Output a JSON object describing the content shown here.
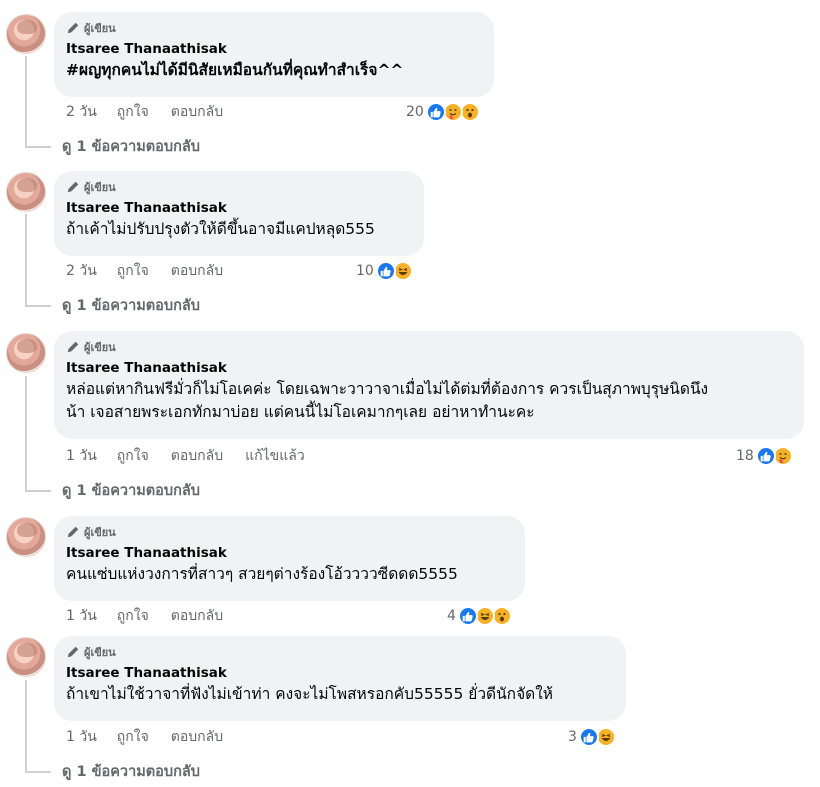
{
  "badge_label": "ผู้เขียน",
  "comments": [
    {
      "author": "Itsaree Thanaathisak",
      "text": "#ผญทุกคนไม่ได้มีนิสัยเหมือนกันที่คุณทำสำเร็จ^^",
      "time": "2 วัน",
      "like": "ถูกใจ",
      "reply": "ตอบกลับ",
      "reaction_count": "20",
      "reaction_icons": [
        "like-icon",
        "care-icon",
        "wow-icon"
      ],
      "view_replies": "ดู 1 ข้อความตอบกลับ"
    },
    {
      "author": "Itsaree Thanaathisak",
      "text": "ถ้าเค้าไม่ปรับปรุงตัวให้ดีขึ้นอาจมีแคปหลุด555",
      "time": "2 วัน",
      "like": "ถูกใจ",
      "reply": "ตอบกลับ",
      "reaction_count": "10",
      "reaction_icons": [
        "like-icon",
        "haha-icon"
      ],
      "view_replies": "ดู 1 ข้อความตอบกลับ"
    },
    {
      "author": "Itsaree Thanaathisak",
      "text_line1": "หล่อแต่หากินฟรีมั่วก็ไม่โอเคค่ะ โดยเฉพาะวาวาจาเมื่อไม่ได้ต่มที่ต้องการ ควรเป็นสุภาพบุรุษนิดนึง",
      "text_line2": "น้า เจอสายพระเอกทักมาบ่อย แต่คนนี้ไม่โอเคมากๆเลย อย่าหาทำนะคะ",
      "time": "1 วัน",
      "like": "ถูกใจ",
      "reply": "ตอบกลับ",
      "edited": "แก้ไขแล้ว",
      "reaction_count": "18",
      "reaction_icons": [
        "like-icon",
        "care-icon"
      ],
      "view_replies": "ดู 1 ข้อความตอบกลับ"
    },
    {
      "author": "Itsaree Thanaathisak",
      "text": "คนแซ่บแห่งวงการที่สาวๆ สวยๆต่างร้องโอ้ววววซีดดด5555",
      "time": "1 วัน",
      "like": "ถูกใจ",
      "reply": "ตอบกลับ",
      "reaction_count": "4",
      "reaction_icons": [
        "like-icon",
        "haha-icon",
        "wow-icon"
      ]
    },
    {
      "author": "Itsaree Thanaathisak",
      "text": "ถ้าเขาไม่ใช้วาจาที่ฟังไม่เข้าท่า คงจะไม่โพสหรอกคับ55555 ยั่วดีนักจัดให้",
      "time": "1 วัน",
      "like": "ถูกใจ",
      "reply": "ตอบกลับ",
      "reaction_count": "3",
      "reaction_icons": [
        "like-icon",
        "haha-icon"
      ],
      "view_replies": "ดู 1 ข้อความตอบกลับ"
    }
  ],
  "colors": {
    "bubble_bg": "#f0f2f5",
    "meta_text": "#65676b",
    "like_blue": "#1877f2",
    "emoji_yellow": "#f7b125"
  }
}
